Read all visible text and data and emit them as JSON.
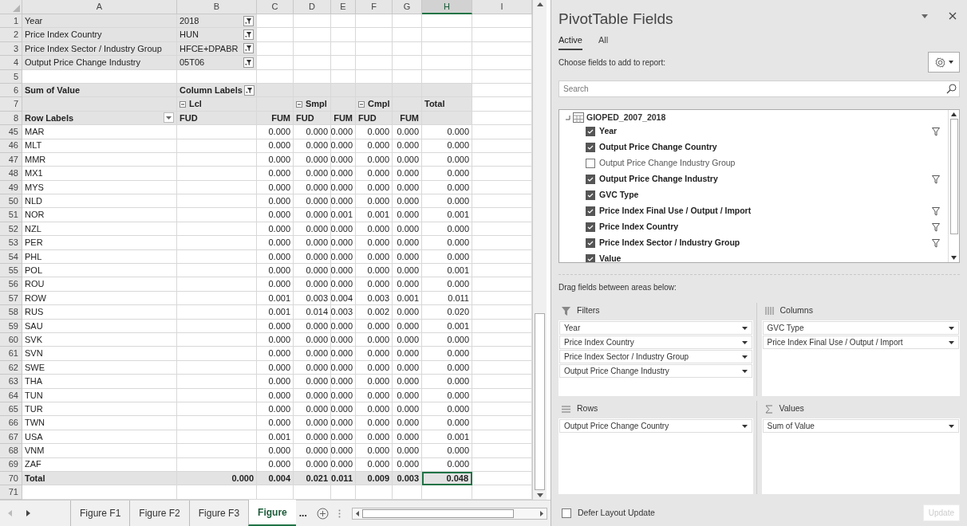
{
  "sheet": {
    "columns": [
      {
        "label": "A",
        "selected": false
      },
      {
        "label": "B",
        "selected": false
      },
      {
        "label": "C",
        "selected": false
      },
      {
        "label": "D",
        "selected": false
      },
      {
        "label": "E",
        "selected": false
      },
      {
        "label": "F",
        "selected": false
      },
      {
        "label": "G",
        "selected": false
      },
      {
        "label": "H",
        "selected": true
      },
      {
        "label": "I",
        "selected": false
      }
    ],
    "rows": [
      {
        "n": "1",
        "kind": "filter",
        "cells": {
          "A": {
            "text": "Year"
          },
          "B": {
            "text": "2018",
            "filter_button": true
          }
        }
      },
      {
        "n": "2",
        "kind": "filter",
        "cells": {
          "A": {
            "text": "Price Index Country"
          },
          "B": {
            "text": "HUN",
            "filter_button": true
          }
        }
      },
      {
        "n": "3",
        "kind": "filter",
        "cells": {
          "A": {
            "text": "Price Index Sector / Industry Group"
          },
          "B": {
            "text": "HFCE+DPABR",
            "filter_button": true
          }
        }
      },
      {
        "n": "4",
        "kind": "filter",
        "cells": {
          "A": {
            "text": "Output Price Change Industry"
          },
          "B": {
            "text": "05T06",
            "filter_button": true
          }
        }
      },
      {
        "n": "5",
        "kind": "blank"
      },
      {
        "n": "6",
        "kind": "header",
        "cells": {
          "A": {
            "text": "Sum of Value"
          },
          "B": {
            "text": "Column Labels",
            "filter_button": true
          }
        }
      },
      {
        "n": "7",
        "kind": "header",
        "cells": {
          "B": {
            "text": "Lcl",
            "collapse": true
          },
          "D": {
            "text": "Smpl",
            "collapse": true
          },
          "F": {
            "text": "Cmpl",
            "collapse": true
          },
          "H": {
            "text": "Total"
          }
        }
      },
      {
        "n": "8",
        "kind": "header",
        "cells": {
          "A": {
            "text": "Row Labels",
            "dropdown": true
          },
          "B": {
            "text": "FUD"
          },
          "C": {
            "text": "FUM"
          },
          "D": {
            "text": "FUD"
          },
          "E": {
            "text": "FUM"
          },
          "F": {
            "text": "FUD"
          },
          "G": {
            "text": "FUM"
          }
        }
      },
      {
        "n": "45",
        "kind": "data",
        "label": "MAR",
        "values": [
          "0.000",
          "0.000",
          "0.000",
          "0.000",
          "0.000",
          "0.000"
        ]
      },
      {
        "n": "46",
        "kind": "data",
        "label": "MLT",
        "values": [
          "0.000",
          "0.000",
          "0.000",
          "0.000",
          "0.000",
          "0.000"
        ]
      },
      {
        "n": "47",
        "kind": "data",
        "label": "MMR",
        "values": [
          "0.000",
          "0.000",
          "0.000",
          "0.000",
          "0.000",
          "0.000"
        ]
      },
      {
        "n": "48",
        "kind": "data",
        "label": "MX1",
        "values": [
          "0.000",
          "0.000",
          "0.000",
          "0.000",
          "0.000",
          "0.000"
        ]
      },
      {
        "n": "49",
        "kind": "data",
        "label": "MYS",
        "values": [
          "0.000",
          "0.000",
          "0.000",
          "0.000",
          "0.000",
          "0.000"
        ]
      },
      {
        "n": "50",
        "kind": "data",
        "label": "NLD",
        "values": [
          "0.000",
          "0.000",
          "0.000",
          "0.000",
          "0.000",
          "0.000"
        ]
      },
      {
        "n": "51",
        "kind": "data",
        "label": "NOR",
        "values": [
          "0.000",
          "0.000",
          "0.001",
          "0.001",
          "0.000",
          "0.001"
        ]
      },
      {
        "n": "52",
        "kind": "data",
        "label": "NZL",
        "values": [
          "0.000",
          "0.000",
          "0.000",
          "0.000",
          "0.000",
          "0.000"
        ]
      },
      {
        "n": "53",
        "kind": "data",
        "label": "PER",
        "values": [
          "0.000",
          "0.000",
          "0.000",
          "0.000",
          "0.000",
          "0.000"
        ]
      },
      {
        "n": "54",
        "kind": "data",
        "label": "PHL",
        "values": [
          "0.000",
          "0.000",
          "0.000",
          "0.000",
          "0.000",
          "0.000"
        ]
      },
      {
        "n": "55",
        "kind": "data",
        "label": "POL",
        "values": [
          "0.000",
          "0.000",
          "0.000",
          "0.000",
          "0.000",
          "0.001"
        ]
      },
      {
        "n": "56",
        "kind": "data",
        "label": "ROU",
        "values": [
          "0.000",
          "0.000",
          "0.000",
          "0.000",
          "0.000",
          "0.000"
        ]
      },
      {
        "n": "57",
        "kind": "data",
        "label": "ROW",
        "values": [
          "0.001",
          "0.003",
          "0.004",
          "0.003",
          "0.001",
          "0.011"
        ]
      },
      {
        "n": "58",
        "kind": "data",
        "label": "RUS",
        "values": [
          "0.001",
          "0.014",
          "0.003",
          "0.002",
          "0.000",
          "0.020"
        ]
      },
      {
        "n": "59",
        "kind": "data",
        "label": "SAU",
        "values": [
          "0.000",
          "0.000",
          "0.000",
          "0.000",
          "0.000",
          "0.001"
        ]
      },
      {
        "n": "60",
        "kind": "data",
        "label": "SVK",
        "values": [
          "0.000",
          "0.000",
          "0.000",
          "0.000",
          "0.000",
          "0.000"
        ]
      },
      {
        "n": "61",
        "kind": "data",
        "label": "SVN",
        "values": [
          "0.000",
          "0.000",
          "0.000",
          "0.000",
          "0.000",
          "0.000"
        ]
      },
      {
        "n": "62",
        "kind": "data",
        "label": "SWE",
        "values": [
          "0.000",
          "0.000",
          "0.000",
          "0.000",
          "0.000",
          "0.000"
        ]
      },
      {
        "n": "63",
        "kind": "data",
        "label": "THA",
        "values": [
          "0.000",
          "0.000",
          "0.000",
          "0.000",
          "0.000",
          "0.000"
        ]
      },
      {
        "n": "64",
        "kind": "data",
        "label": "TUN",
        "values": [
          "0.000",
          "0.000",
          "0.000",
          "0.000",
          "0.000",
          "0.000"
        ]
      },
      {
        "n": "65",
        "kind": "data",
        "label": "TUR",
        "values": [
          "0.000",
          "0.000",
          "0.000",
          "0.000",
          "0.000",
          "0.000"
        ]
      },
      {
        "n": "66",
        "kind": "data",
        "label": "TWN",
        "values": [
          "0.000",
          "0.000",
          "0.000",
          "0.000",
          "0.000",
          "0.000"
        ]
      },
      {
        "n": "67",
        "kind": "data",
        "label": "USA",
        "values": [
          "0.001",
          "0.000",
          "0.000",
          "0.000",
          "0.000",
          "0.001"
        ]
      },
      {
        "n": "68",
        "kind": "data",
        "label": "VNM",
        "values": [
          "0.000",
          "0.000",
          "0.000",
          "0.000",
          "0.000",
          "0.000"
        ]
      },
      {
        "n": "69",
        "kind": "data",
        "label": "ZAF",
        "values": [
          "0.000",
          "0.000",
          "0.000",
          "0.000",
          "0.000",
          "0.000"
        ]
      },
      {
        "n": "70",
        "kind": "total",
        "label": "Total",
        "lead_value": "0.000",
        "values": [
          {
            "text": "0.004",
            "selected": false
          },
          {
            "text": "0.021",
            "selected": false
          },
          {
            "text": "0.011",
            "selected": false
          },
          {
            "text": "0.009",
            "selected": false
          },
          {
            "text": "0.003",
            "selected": false
          },
          {
            "text": "0.048",
            "selected": true
          }
        ]
      },
      {
        "n": "71",
        "kind": "blank"
      }
    ],
    "sheet_tabs": [
      {
        "label": "Figure F1",
        "selected": false
      },
      {
        "label": "Figure F2",
        "selected": false
      },
      {
        "label": "Figure F3",
        "selected": false
      },
      {
        "label": "Figure",
        "selected": true
      }
    ],
    "more_tabs": "..."
  },
  "pane": {
    "title": "PivotTable Fields",
    "tabs": [
      {
        "label": "Active",
        "selected": true
      },
      {
        "label": "All",
        "selected": false
      }
    ],
    "choose_label": "Choose fields to add to report:",
    "search": {
      "placeholder": "Search"
    },
    "table_name": "GIOPED_2007_2018",
    "fields": [
      {
        "label": "Year",
        "checked": true,
        "filtered": true
      },
      {
        "label": "Output Price Change Country",
        "checked": true,
        "filtered": false
      },
      {
        "label": "Output Price Change Industry Group",
        "checked": false,
        "filtered": false
      },
      {
        "label": "Output Price Change Industry",
        "checked": true,
        "filtered": true
      },
      {
        "label": "GVC Type",
        "checked": true,
        "filtered": false
      },
      {
        "label": "Price Index Final Use / Output / Import",
        "checked": true,
        "filtered": true
      },
      {
        "label": "Price Index Country",
        "checked": true,
        "filtered": true
      },
      {
        "label": "Price Index Sector / Industry Group",
        "checked": true,
        "filtered": true
      },
      {
        "label": "Value",
        "checked": true,
        "filtered": false
      }
    ],
    "drag_label": "Drag fields between areas below:",
    "areas": [
      {
        "kind": "filters",
        "title": "Filters",
        "items": [
          "Year",
          "Price Index Country",
          "Price Index Sector / Industry Group",
          "Output Price Change Industry"
        ]
      },
      {
        "kind": "columns",
        "title": "Columns",
        "items": [
          "GVC Type",
          "Price Index Final Use / Output / Import"
        ]
      },
      {
        "kind": "rows",
        "title": "Rows",
        "items": [
          "Output Price Change Country"
        ]
      },
      {
        "kind": "values",
        "title": "Values",
        "items": [
          "Sum of Value"
        ]
      }
    ],
    "defer": {
      "label": "Defer Layout Update",
      "checked": false
    },
    "update_button": {
      "label": "Update",
      "disabled": true
    }
  }
}
